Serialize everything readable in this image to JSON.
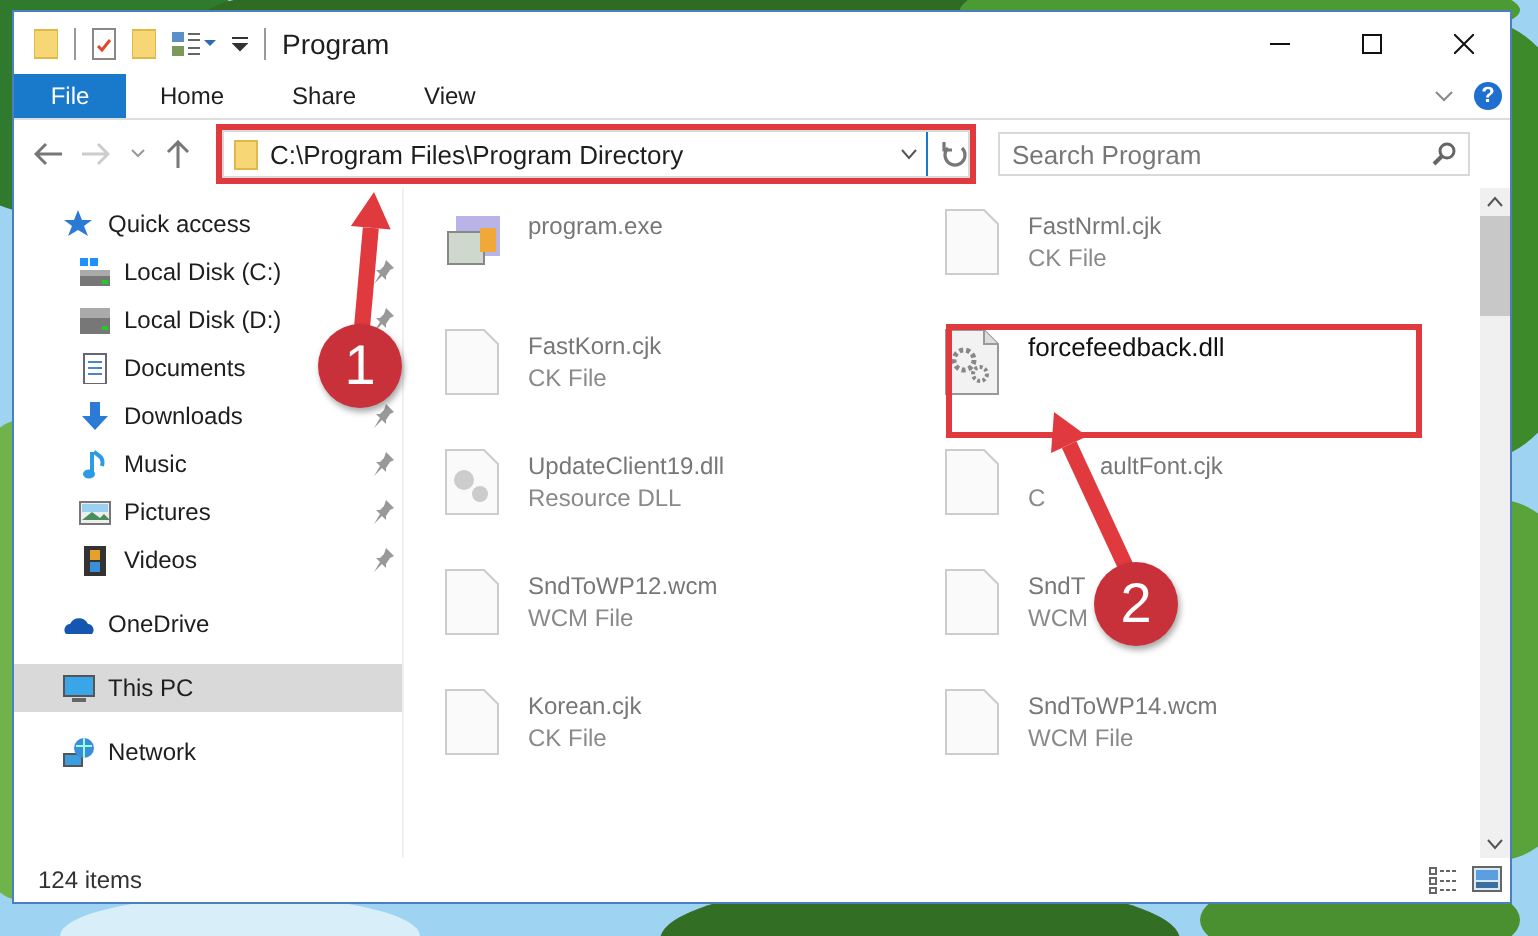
{
  "window": {
    "title": "Program"
  },
  "ribbon": {
    "tabs": [
      {
        "label": "File",
        "selected": true
      },
      {
        "label": "Home",
        "selected": false
      },
      {
        "label": "Share",
        "selected": false
      },
      {
        "label": "View",
        "selected": false
      }
    ],
    "help": "?"
  },
  "address": {
    "path": "C:\\Program Files\\Program Directory"
  },
  "search": {
    "placeholder": "Search Program"
  },
  "nav_pane": {
    "items": [
      {
        "label": "Quick access",
        "kind": "star",
        "selected": false,
        "children": [
          {
            "label": "Local Disk (C:)",
            "kind": "drive-system",
            "pinned": true,
            "selected": false
          },
          {
            "label": "Local Disk (D:)",
            "kind": "drive",
            "pinned": true,
            "selected": false
          },
          {
            "label": "Documents",
            "kind": "document",
            "pinned": false,
            "selected": false
          },
          {
            "label": "Downloads",
            "kind": "download",
            "pinned": true,
            "selected": false
          },
          {
            "label": "Music",
            "kind": "note",
            "pinned": true,
            "selected": false
          },
          {
            "label": "Pictures",
            "pinned": true,
            "selected": false
          },
          {
            "label": "Videos",
            "kind": "film",
            "pinned": true,
            "selected": false
          }
        ]
      },
      {
        "label": "OneDrive",
        "kind": "cloud",
        "selected": false
      },
      {
        "label": "This PC",
        "kind": "monitor",
        "selected": true
      },
      {
        "label": "Network",
        "kind": "globe",
        "selected": false
      }
    ]
  },
  "files": [
    {
      "name": "program.exe",
      "kind": "app",
      "sharp": false
    },
    {
      "name": "FastNrml.cjk",
      "type": "CK File",
      "kind": "blank",
      "sharp": false
    },
    {
      "name": "FastKorn.cjk",
      "type": "CK File",
      "kind": "blank",
      "sharp": false
    },
    {
      "name": "forcefeedback.dll",
      "kind": "gears",
      "sharp": true
    },
    {
      "name": "UpdateClient19.dll",
      "type": "Resource DLL",
      "kind": "gears-faint",
      "sharp": false
    },
    {
      "name": "aultFont.cjk",
      "type": "C",
      "kind": "blank",
      "sharp": false,
      "covered": true
    },
    {
      "name": "SndToWP12.wcm",
      "type": "WCM File",
      "kind": "blank",
      "sharp": false
    },
    {
      "name": "SndT",
      "type": "WCM",
      "kind": "blank",
      "sharp": false
    },
    {
      "name": "Korean.cjk",
      "type": "CK File",
      "kind": "blank",
      "sharp": false
    },
    {
      "name": "SndToWP14.wcm",
      "type": "WCM File",
      "kind": "blank",
      "sharp": false
    }
  ],
  "status_bar": {
    "count": "124 items"
  },
  "annotations": [
    {
      "label": "1"
    },
    {
      "label": "2"
    }
  ]
}
